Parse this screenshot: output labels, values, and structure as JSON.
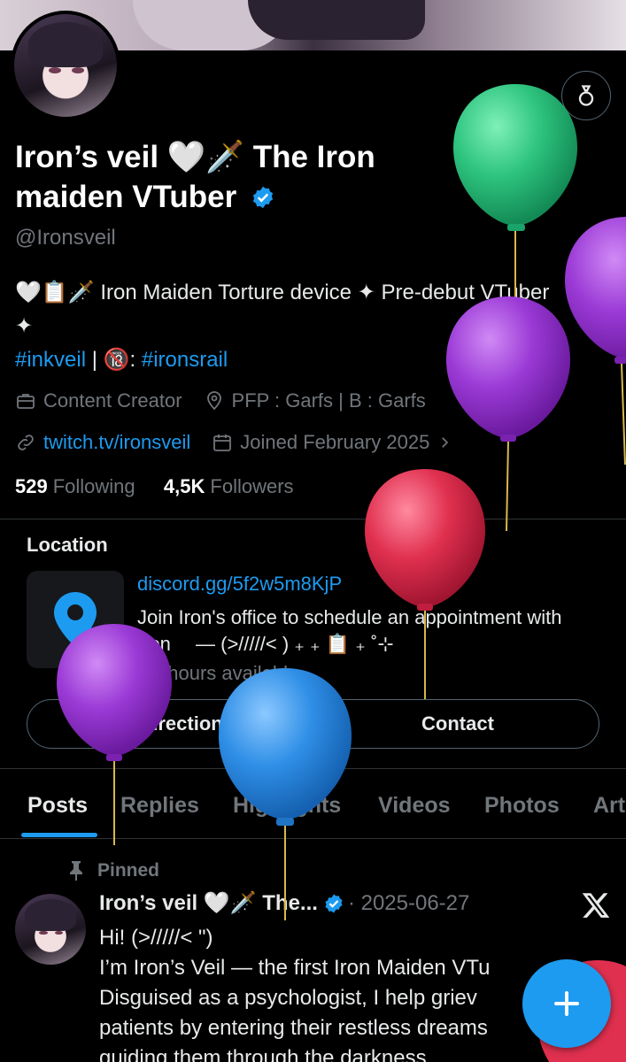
{
  "profile": {
    "display_name": "Iron’s veil 🤍🗡️ The Iron maiden VTuber",
    "handle": "@Ironsveil",
    "bio_line1": "🤍📋🗡️ Iron Maiden Torture device ✦ Pre-debut VTuber ✦",
    "bio_tag1": "#inkveil",
    "bio_sep": " | 🔞: ",
    "bio_tag2": "#ironsrail",
    "category": "Content Creator",
    "location": "PFP : Garfs | B : Garfs",
    "website": "twitch.tv/ironsveil",
    "joined": "Joined February 2025",
    "following_count": "529",
    "following_label": "Following",
    "followers_count": "4,5K",
    "followers_label": "Followers"
  },
  "location_card": {
    "title": "Location",
    "link": "discord.gg/5f2w5m8KjP",
    "description": "Join Iron's office to schedule an appointment with Iron 　— (>/////< ) ₊ ₊ 📋 ₊ ˚⊹",
    "hours": "No hours available",
    "directions_button": "Get directions",
    "contact_button": "Contact"
  },
  "tabs": [
    {
      "label": "Posts"
    },
    {
      "label": "Replies"
    },
    {
      "label": "Highlights"
    },
    {
      "label": "Videos"
    },
    {
      "label": "Photos"
    },
    {
      "label": "Art"
    }
  ],
  "post": {
    "pinned_label": "Pinned",
    "author": "Iron’s veil 🤍🗡️ The...",
    "date": "· 2025-06-27",
    "lines": [
      "Hi! (>/////< \")",
      "I’m Iron’s Veil — the first Iron Maiden VTu",
      "Disguised as a psychologist, I help griev",
      "patients by entering their restless dreams",
      "guiding them through the darkness"
    ]
  },
  "colors": {
    "accent": "#1d9bf0",
    "balloon_green": "#2ec47f",
    "balloon_purple": "#9b3ad6",
    "balloon_red": "#e0304f",
    "balloon_blue": "#2f8fe6"
  },
  "icons": [
    "bag-icon",
    "verified-icon",
    "briefcase-icon",
    "location-pin-icon",
    "link-icon",
    "calendar-icon",
    "chevron-right-icon",
    "map-pin-icon",
    "pin-icon",
    "x-logo-icon",
    "plus-icon"
  ]
}
